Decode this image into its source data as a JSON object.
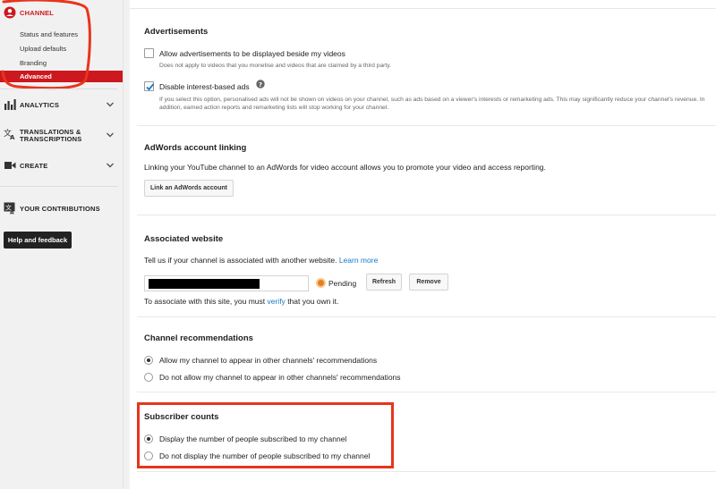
{
  "sidebar": {
    "channel_label": "CHANNEL",
    "channel_items": [
      "Status and features",
      "Upload defaults",
      "Branding"
    ],
    "active_item": "Advanced",
    "analytics_label": "ANALYTICS",
    "translations_label_1": "TRANSLATIONS &",
    "translations_label_2": "TRANSCRIPTIONS",
    "create_label": "CREATE",
    "contributions_label": "YOUR CONTRIBUTIONS",
    "help_button": "Help and feedback"
  },
  "ads": {
    "title": "Advertisements",
    "opt1_label": "Allow advertisements to be displayed beside my videos",
    "opt1_checked": false,
    "opt1_note": "Does not apply to videos that you monetise and videos that are claimed by a third party.",
    "opt2_label": "Disable interest-based ads",
    "opt2_checked": true,
    "opt2_note": "If you select this option, personalised ads will not be shown on videos on your channel, such as ads based on a viewer's interests or remarketing ads. This may significantly reduce your channel's revenue. In addition, earned action reports and remarketing lists will stop working for your channel."
  },
  "adwords": {
    "title": "AdWords account linking",
    "description": "Linking your YouTube channel to an AdWords for video account allows you to promote your video and access reporting.",
    "button": "Link an AdWords account"
  },
  "website": {
    "title": "Associated website",
    "description_pre": "Tell us if your channel is associated with another website.",
    "learn_more": "Learn more",
    "status": "Pending",
    "refresh_button": "Refresh",
    "remove_button": "Remove",
    "verify_pre": "To associate with this site, you must",
    "verify_link": "verify",
    "verify_post": "that you own it."
  },
  "recommendations": {
    "title": "Channel recommendations",
    "opt1": "Allow my channel to appear in other channels' recommendations",
    "opt2": "Do not allow my channel to appear in other channels' recommendations",
    "selected": 1
  },
  "subscribers": {
    "title": "Subscriber counts",
    "opt1": "Display the number of people subscribed to my channel",
    "opt2": "Do not display the number of people subscribed to my channel",
    "selected": 1
  },
  "colors": {
    "accent_red": "#cc181e",
    "annotation_red": "#e8341c",
    "link_blue": "#167ac6"
  }
}
